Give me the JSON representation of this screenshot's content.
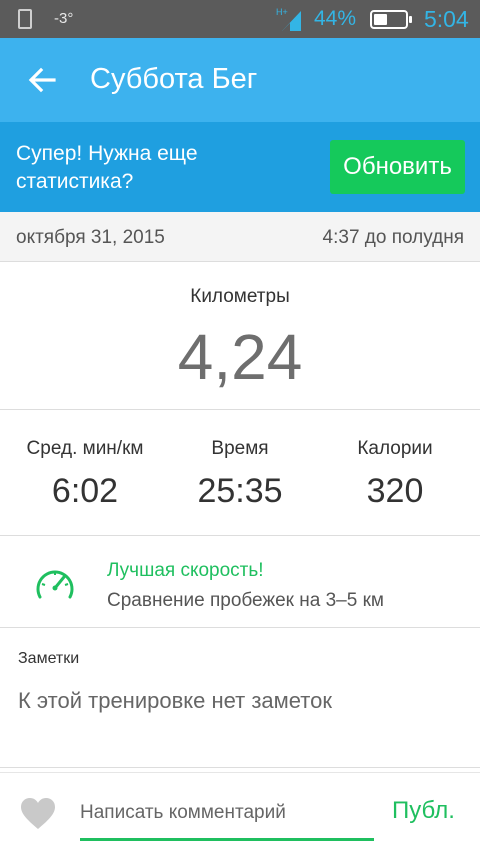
{
  "status_bar": {
    "temperature": "-3°",
    "network": "H+",
    "battery_percent": "44%",
    "battery_level": 0.44,
    "clock": "5:04",
    "icons": [
      "phone-icon",
      "signal-icon",
      "battery-icon"
    ]
  },
  "app_bar": {
    "title": "Суббота Бег",
    "back_icon": "arrow-left-icon"
  },
  "promo": {
    "text": "Супер! Нужна еще статистика?",
    "button_label": "Обновить",
    "button_color": "#15c95b"
  },
  "workout": {
    "date": "октября 31, 2015",
    "time": "4:37 до полудня"
  },
  "distance": {
    "label": "Километры",
    "value": "4,24"
  },
  "stats": [
    {
      "label": "Сред. мин/км",
      "value": "6:02"
    },
    {
      "label": "Время",
      "value": "25:35"
    },
    {
      "label": "Калории",
      "value": "320"
    }
  ],
  "best_speed": {
    "icon": "speedometer-icon",
    "title": "Лучшая скорость!",
    "subtitle": "Сравнение пробежек на 3–5 км",
    "accent_color": "#1fbf5f"
  },
  "notes": {
    "label": "Заметки",
    "text": "К этой тренировке нет заметок"
  },
  "comment_bar": {
    "like_icon": "heart-icon",
    "placeholder": "Написать комментарий",
    "publish_label": "Публ."
  },
  "colors": {
    "app_bar": "#3db2ee",
    "promo_bar": "#1f9fe0",
    "accent_green": "#1fbf5f"
  }
}
